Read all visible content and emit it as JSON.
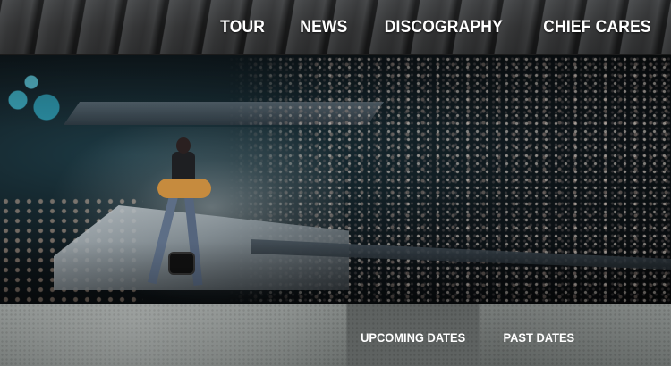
{
  "nav": {
    "items": [
      {
        "label": "TOUR"
      },
      {
        "label": "NEWS"
      },
      {
        "label": "DISCOGRAPHY"
      },
      {
        "label": "CHIEF CARES"
      }
    ]
  },
  "hero": {
    "image": "concert-stage-photo"
  },
  "tour_tabs": {
    "active_index": 0,
    "items": [
      {
        "label": "UPCOMING DATES"
      },
      {
        "label": "PAST DATES"
      }
    ]
  },
  "colors": {
    "nav_text": "#ffffff",
    "active_tab_bg": "#5e6261",
    "subbar_bg": "#7d8280"
  }
}
